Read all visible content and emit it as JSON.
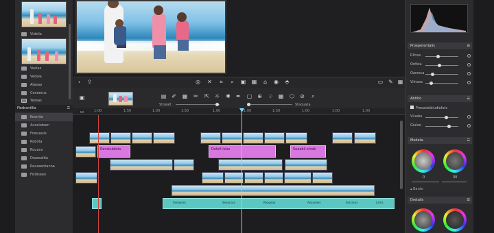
{
  "left_panel": {
    "folders_top": [
      "Videlia",
      "Veolas",
      "Vedaia",
      "Atasaa",
      "Coneerus",
      "Yeosas"
    ],
    "section_title": "Fiedrantllia",
    "folders_bottom": [
      "Koonita",
      "Aunsiobam",
      "Fossuasis",
      "Robota",
      "Rouans",
      "Dearealtia",
      "Reuseentanna",
      "Fistllseen"
    ]
  },
  "timeline": {
    "ruler_ticks": [
      "1:00",
      "1:50",
      "1:00",
      "1:50",
      "1:00",
      "1:00",
      "1:50",
      "1:00",
      "1:00",
      "1:00"
    ],
    "toolbar_label_left": "Stoealt",
    "toolbar_label_right": "Staouata",
    "pink_clips": [
      {
        "label": "Renskubbiia"
      },
      {
        "label": "Detsfi lslas"
      },
      {
        "label": "Seaabil-shnbi"
      }
    ],
    "teal_labels": [
      "Seeaaoss",
      "Seaacoss",
      "Rooqeaa",
      "Aoaueaes",
      "Sorrasas",
      "Laiirs"
    ]
  },
  "right_panel": {
    "properties": {
      "title": "Proeperentalis",
      "rows": [
        "Rllnsa",
        "Ontbia",
        "Oaresca",
        "Vilnasa"
      ]
    },
    "audio": {
      "title": "Abtlito",
      "checkbox": "Preoadsibiudiofuts",
      "rows": [
        "Vluabe",
        "Giuleo"
      ]
    },
    "media": {
      "title": "Medata",
      "val_left": "0",
      "val_right": "30",
      "footer": "Bauto"
    },
    "details": {
      "title": "Dretails"
    }
  },
  "colors": {
    "accent": "#7fd8ff",
    "pink_clip": "#d977e0",
    "teal_clip": "#5cc7c0"
  }
}
